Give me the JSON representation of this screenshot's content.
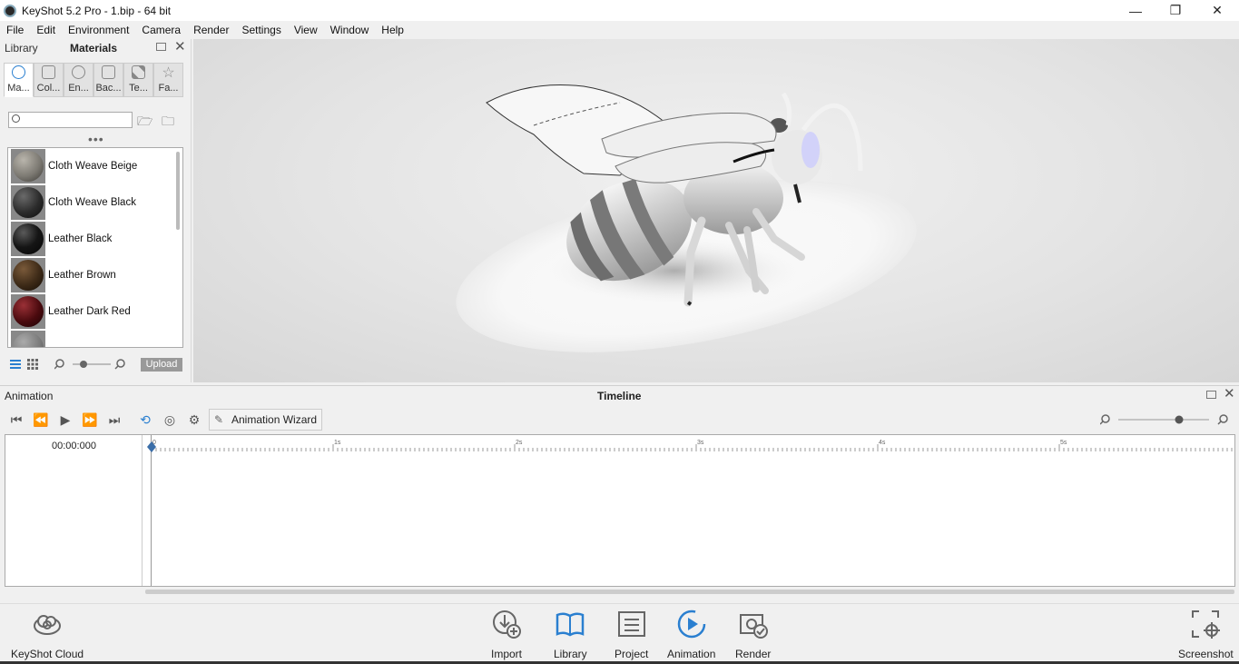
{
  "window": {
    "title": "KeyShot 5.2 Pro  - 1.bip  - 64 bit",
    "controls": {
      "minimize": "—",
      "restore": "❐",
      "close": "✕"
    }
  },
  "menu": [
    "File",
    "Edit",
    "Environment",
    "Camera",
    "Render",
    "Settings",
    "View",
    "Window",
    "Help"
  ],
  "library": {
    "label": "Library",
    "panel_title": "Materials",
    "tabs": [
      {
        "label": "Ma...",
        "icon": "material-icon",
        "active": true
      },
      {
        "label": "Col...",
        "icon": "color-icon",
        "active": false
      },
      {
        "label": "En...",
        "icon": "environment-icon",
        "active": false
      },
      {
        "label": "Bac...",
        "icon": "backplate-icon",
        "active": false
      },
      {
        "label": "Te...",
        "icon": "texture-icon",
        "active": false
      },
      {
        "label": "Fa...",
        "icon": "favorites-icon",
        "active": false
      }
    ],
    "search": {
      "value": "",
      "placeholder": ""
    },
    "materials": [
      {
        "name": "Cloth Weave Beige",
        "color": "#7d7a73"
      },
      {
        "name": "Cloth Weave Black",
        "color": "#2b2b2b"
      },
      {
        "name": "Leather Black",
        "color": "#151515"
      },
      {
        "name": "Leather Brown",
        "color": "#3d2a17"
      },
      {
        "name": "Leather Dark Red",
        "color": "#4a0a0e"
      }
    ],
    "upload_label": "Upload"
  },
  "animation": {
    "panel_label": "Animation",
    "timeline_title": "Timeline",
    "wizard_label": "Animation Wizard",
    "current_time": "00:00:000",
    "ruler_labels": [
      "0",
      "1s",
      "2s",
      "3s",
      "4s",
      "5s"
    ]
  },
  "bottom": {
    "cloud": "KeyShot Cloud",
    "import": "Import",
    "library": "Library",
    "project": "Project",
    "animation": "Animation",
    "render": "Render",
    "screenshot": "Screenshot"
  },
  "colors": {
    "accent": "#2a7fd0",
    "upload_bg": "#999999"
  }
}
